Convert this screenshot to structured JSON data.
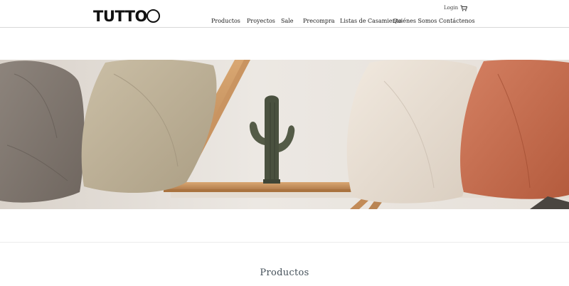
{
  "brand": {
    "logo_text": "TUTTO"
  },
  "header": {
    "login_label": "Login",
    "nav": [
      "Productos",
      "Proyectos",
      "Sale",
      "Precompra",
      "Listas de Casamiento",
      "Quiénes Somos",
      "Contáctenos"
    ]
  },
  "main": {
    "section_title": "Productos"
  },
  "icons": {
    "cart": "cart-icon"
  },
  "colors": {
    "nav_text": "#222222",
    "section_title": "#445059",
    "pillow_terracotta": "#c66a4a"
  }
}
